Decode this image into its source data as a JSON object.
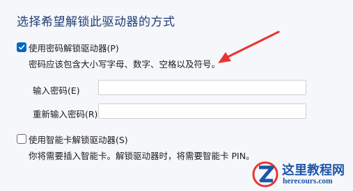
{
  "heading": "选择希望解锁此驱动器的方式",
  "password_option": {
    "label": "使用密码解锁驱动器(P)",
    "checked": true,
    "hint": "密码应该包含大小写字母、数字、空格以及符号。"
  },
  "fields": {
    "password_label": "输入密码(E)",
    "password_value": "",
    "reenter_label": "重新输入密码(R)",
    "reenter_value": ""
  },
  "smartcard_option": {
    "label": "使用智能卡解锁驱动器(S)",
    "checked": false,
    "hint": "你将需要插入智能卡。解锁驱动器时，将需要智能卡 PIN。"
  },
  "watermark": {
    "title": "这里教程网",
    "url": "herecours.com"
  },
  "colors": {
    "accent": "#0067c0",
    "heading": "#1f3c73",
    "arrow": "#e8362f",
    "watermark_blue": "#1d56a8"
  }
}
